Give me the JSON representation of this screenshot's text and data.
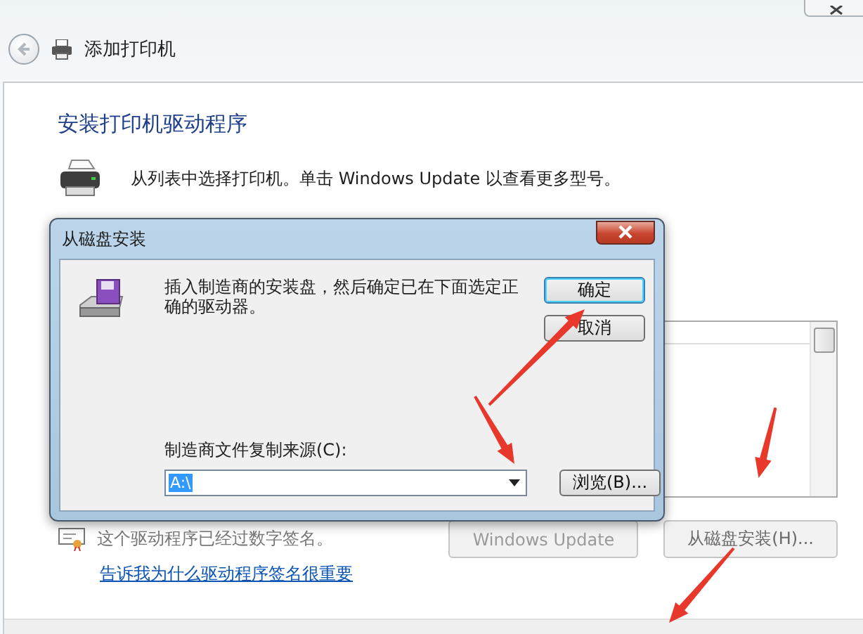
{
  "wizard": {
    "title": "添加打印机",
    "heading": "安装打印机驱动程序",
    "description": "从列表中选择打印机。单击 Windows Update 以查看更多型号。",
    "signature_note": "这个驱动程序已经过数字签名。",
    "buttons": [
      {
        "label": "Windows Update",
        "disabled": true
      },
      {
        "label": "从磁盘安装(H)...",
        "disabled": false
      }
    ],
    "link": "告诉我为什么驱动程序签名很重要"
  },
  "dialog": {
    "title": "从磁盘安装",
    "message": "插入制造商的安装盘，然后确定已在下面选定正确的驱动器。",
    "buttons": [
      {
        "label": "确定",
        "default": true
      },
      {
        "label": "取消",
        "default": false
      }
    ],
    "source_label": "制造商文件复制来源(C):",
    "source_value": "A:\\",
    "browse_button": "浏览(B)..."
  }
}
